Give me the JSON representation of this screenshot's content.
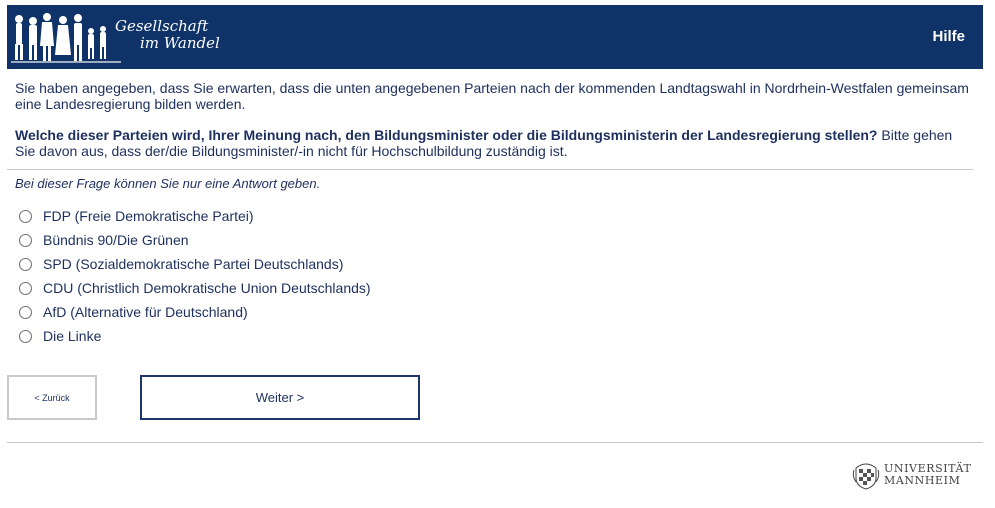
{
  "header": {
    "logo_line1": "Gesellschaft",
    "logo_line2": "im Wandel",
    "help_label": "Hilfe"
  },
  "intro_text": "Sie haben angegeben, dass Sie erwarten, dass die unten angegebenen Parteien nach der kommenden Landtagswahl in Nordrhein-Westfalen gemeinsam eine Landesregierung bilden werden.",
  "question": {
    "bold": "Welche dieser Parteien wird, Ihrer Meinung nach, den Bildungsminister oder die Bildungsministerin der Landesregierung stellen?",
    "rest": " Bitte gehen Sie davon aus, dass der/die Bildungsminister/-in nicht für Hochschulbildung zuständig ist."
  },
  "note": "Bei dieser Frage können Sie nur eine Antwort geben.",
  "options": [
    "FDP (Freie Demokratische Partei)",
    "Bündnis 90/Die Grünen",
    "SPD (Sozialdemokratische Partei Deutschlands)",
    "CDU (Christlich Demokratische Union Deutschlands)",
    "AfD (Alternative für Deutschland)",
    "Die Linke"
  ],
  "buttons": {
    "back_label": "< Zurück",
    "next_label": "Weiter >"
  },
  "footer": {
    "uni_line1": "UNIVERSITÄT",
    "uni_line2": "MANNHEIM"
  },
  "colors": {
    "header_bg": "#0f3268",
    "text": "#1d2f5e"
  }
}
